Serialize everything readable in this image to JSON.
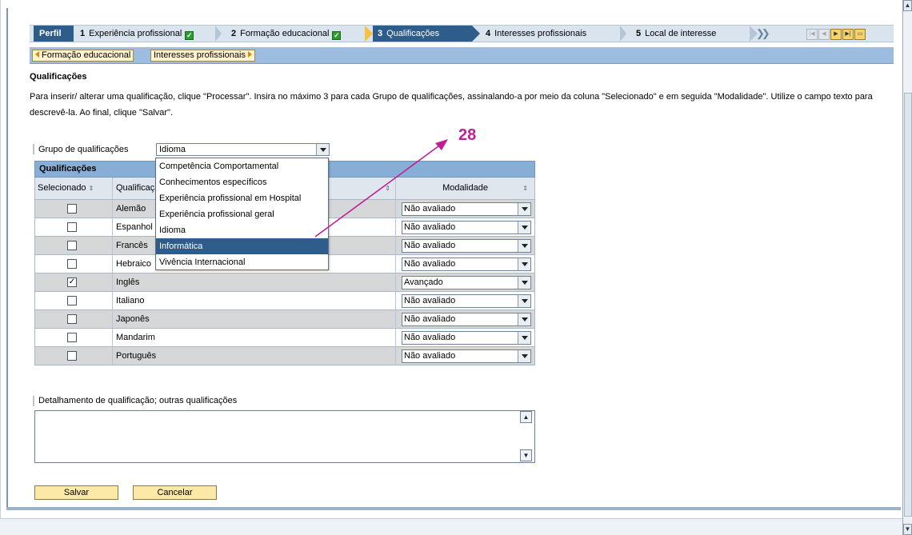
{
  "roadmap": {
    "profile": "Perfil",
    "steps": [
      {
        "num": "1",
        "label": "Experiência profissional"
      },
      {
        "num": "2",
        "label": "Formação educacional"
      },
      {
        "num": "3",
        "label": "Qualificações"
      },
      {
        "num": "4",
        "label": "Interesses profissionais"
      },
      {
        "num": "5",
        "label": "Local de interesse"
      }
    ]
  },
  "crumbs": {
    "back": "Formação educacional",
    "next": "Interesses profissionais"
  },
  "page": {
    "title": "Qualificações",
    "instructions": "Para inserir/ alterar uma qualificação, clique \"Processar\". Insira no máximo 3 para cada Grupo de qualificações, assinalando-a por meio da coluna \"Selecionado\" e em seguida \"Modalidade\". Utilize o campo texto para descrevê-la. Ao final, clique \"Salvar\"."
  },
  "group": {
    "label": "Grupo de qualificações",
    "value": "Idioma",
    "options": [
      "Competência Comportamental",
      "Conhecimentos específicos",
      "Experiência profissional em Hospital",
      "Experiência profissional geral",
      "Idioma",
      "Informática",
      "Vivência Internacional"
    ],
    "highlighted": "Informática"
  },
  "table": {
    "title": "Qualificações",
    "headers": {
      "selected": "Selecionado",
      "qualification": "Qualificação",
      "mode": "Modalidade"
    },
    "rows": [
      {
        "name": "Alemão",
        "checked": "",
        "mode": "Não avaliado"
      },
      {
        "name": "Espanhol",
        "checked": "",
        "mode": "Não avaliado"
      },
      {
        "name": "Francês",
        "checked": "",
        "mode": "Não avaliado"
      },
      {
        "name": "Hebraico",
        "checked": "",
        "mode": "Não avaliado"
      },
      {
        "name": "Inglês",
        "checked": "✓",
        "mode": "Avançado"
      },
      {
        "name": "Italiano",
        "checked": "",
        "mode": "Não avaliado"
      },
      {
        "name": "Japonês",
        "checked": "",
        "mode": "Não avaliado"
      },
      {
        "name": "Mandarim",
        "checked": "",
        "mode": "Não avaliado"
      },
      {
        "name": "Português",
        "checked": "",
        "mode": "Não avaliado"
      }
    ]
  },
  "annotation": {
    "number": "28",
    "color": "#c21e93"
  },
  "detail": {
    "label": "Detalhamento de qualificação; outras qualificações",
    "value": ""
  },
  "buttons": {
    "save": "Salvar",
    "cancel": "Cancelar"
  },
  "colors": {
    "accent": "#2e5d8c",
    "header_bar": "#86aed6",
    "button_bg": "#fde9a7"
  }
}
